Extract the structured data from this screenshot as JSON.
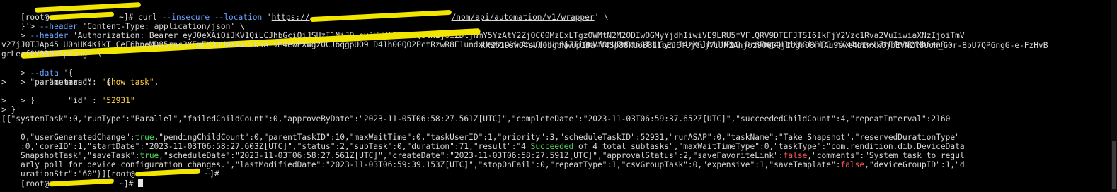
{
  "terminal": {
    "lines": {
      "l0": "[root@",
      "l0b": " ~]# curl ",
      "l0c": "--insecure --location",
      "l0d": " '",
      "l0e": "https://",
      "l0f": "/nom/api/automation/v1/wrapper",
      "l0g": "' \\",
      "l1a": "}'> ",
      "l1b": "--header",
      "l1c": " 'Content-Type: application/json' \\",
      "l2a": "> ",
      "l2b": "--header",
      "l2c": " 'Authorization: Bearer eyJ0eXAiOiJKV1QiLCJhbGciOiJSUzI1NiJ9.eyJVVUlEX0NMQUlNIjoiZDljNmY5YzAtY2ZjOC00MzExLTgzOWMtN2M2ODIwOGMyYjdhIiwiVE9LRU5fVFlQRV9DTEFJTSI6IkFjY2Vzc1Rva2VuIiwiaXNzIjoiTmV",
      "l3a": "kXZo19swO4sVlObgcNwupIOa-V4Sp88kuoB81IpEJ6fUjtLj7iJMZAnjoz9065QjIogrO8nlAu9swt4bImxx6jbEVNZl8Uoh_G0r-8pU7QP6ngG-e-FzHvB",
      "l4": "v27jJ0TJAp45_U0hHK4KikT_CeF6hneMD85rnc3YEmEKOuHwzVvPuD9A-vM4ewPXWgz0CJbqgpUO9_D41h0GQO2PctRzwR8E1undxHeWzuYduAbvQHHHp6j7IiQmVf0tHEWBt6GTUU3yhLI4zXGlb11UPWQ_Dr6Fmg4HJdXtGiYYBQ_nYx4waseHZtFfm3RYMb6ea8",
      "l5": "grLezf0Y9RN3SpVphg' \\",
      "l6a": "> ",
      "l6b": "--data",
      "l6c": " '{",
      "l7": ">     \"command\": ",
      "l7s": "\"show task\"",
      "l7e": ",",
      "l8": ">     \"parameters\":   {",
      "l9": ">         \"id\" : ",
      "l9s": "\"52931\"",
      "l10": ">     }",
      "l11": "> }'",
      "l12a": "[{\"systemTask\":0,\"runType\":\"Parallel\",\"failedChildCount\":0,\"approveByDate\":\"2023-11-05T06:58:27.561Z[UTC]\",\"completeDate\":\"2023-11-03T06:59:37.652Z[UTC]\",\"succeededChildCount\":4,\"repeatInterval\":2160",
      "l13a": "0,\"userGeneratedChange\":",
      "l13b": "true",
      "l13c": ",\"pendingChildCount\":0,\"parentTaskID\":10,\"maxWaitTime\":0,\"taskUserID\":1,\"priority\":3,\"scheduleTaskID\":52931,\"runASAP\":0,\"taskName\":\"Take Snapshot\",\"reservedDurationType\"",
      "l14a": ":0,\"coreID\":1,\"startDate\":\"2023-11-03T06:58:27.603Z[UTC]\",\"status\":2,\"subTask\":0,\"duration\":71,\"result\":\"4 ",
      "l14b": "Succeeded",
      "l14c": " of 4 total subtasks\",\"maxWaitTimeType\":0,\"taskType\":\"com.rendition.dib.DeviceData",
      "l15a": "SnapshotTask\",\"saveTask\":",
      "l15b": "true",
      "l15c": ",\"scheduleDate\":\"2023-11-03T06:58:27.561Z[UTC]\",\"createDate\":\"2023-11-03T06:58:27.591Z[UTC]\",\"approvalStatus\":2,\"saveFavoriteLink\":",
      "l15d": "false",
      "l15e": ",\"comments\":\"System task to regul",
      "l16": "arly poll for device configuration changes.\",\"lastModifiedDate\":\"2023-11-03T06:59:39.153Z[UTC]\",\"stopOnFail\":0,\"repeatType\":1,\"csvGroupTask\":0,\"expensive\":1,\"saveTemplate\":",
      "l16b": "false",
      "l16c": ",\"deviceGroupID\":1,\"d",
      "l17a": "urationStr\":\"60\"}][root@",
      "l17b": " ~]#",
      "l18a": "[root@",
      "l18b": " ~]# "
    }
  },
  "colors": {
    "background": "#000000",
    "text": "#d9d9d9",
    "redaction": "#f2e600",
    "flag": "#6aa3ff",
    "string": "#ffd43b",
    "true": "#4de05b",
    "false": "#ff5b5b"
  }
}
